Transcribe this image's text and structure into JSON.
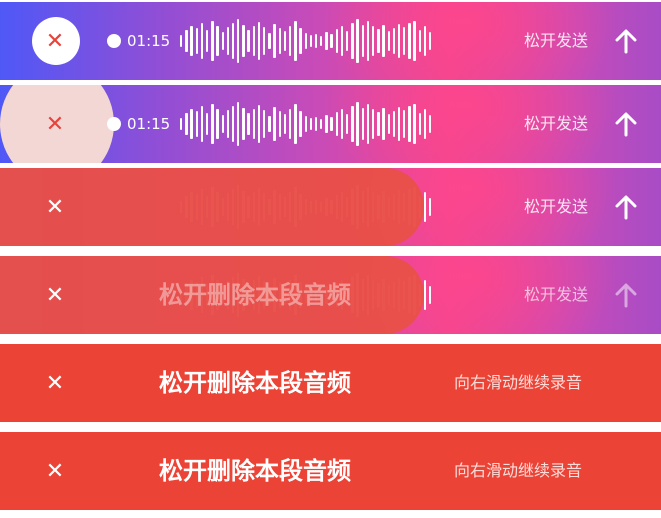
{
  "time": "01:15",
  "send_label": "松开发送",
  "delete_label": "松开删除本段音频",
  "slide_label": "向右滑动继续录音",
  "close_glyph": "✕",
  "colors": {
    "gradient_start": "#4f58f7",
    "gradient_mid": "#f2468f",
    "gradient_end": "#a84cc6",
    "cancel_red": "#eb4336"
  },
  "icons": [
    "close-icon",
    "record-dot-icon",
    "waveform-icon",
    "arrow-up-icon"
  ]
}
